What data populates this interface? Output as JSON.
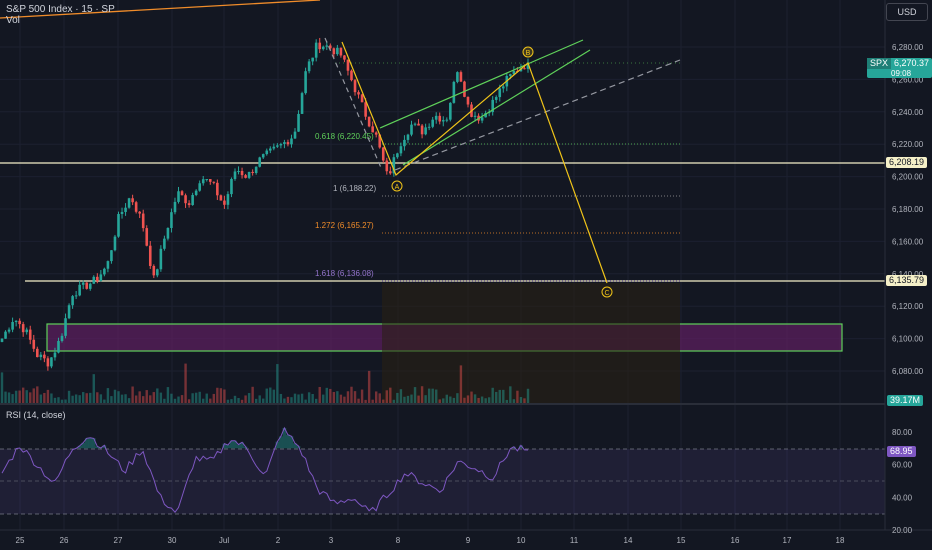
{
  "header": {
    "title": "S&P 500 Index · 15 · SP",
    "volume_label": "Vol",
    "currency_button": "USD",
    "rsi_label": "RSI (14, close)"
  },
  "price_axis": {
    "ticks": [
      "6,280.00",
      "6,260.00",
      "6,240.00",
      "6,220.00",
      "6,200.00",
      "6,180.00",
      "6,160.00",
      "6,140.00",
      "6,120.00",
      "6,100.00",
      "6,080.00"
    ],
    "last_symbol": "SPX",
    "last_price": "6,270.37",
    "last_countdown": "09:08",
    "level_high_label": "6,208.19",
    "level_low_label": "6,135.79",
    "volume_value": "39.17M"
  },
  "rsi_axis": {
    "ticks": [
      "80.00",
      "60.00",
      "40.00",
      "20.00"
    ],
    "value": "68.95"
  },
  "time_axis": {
    "ticks": [
      "25",
      "26",
      "27",
      "30",
      "Jul",
      "2",
      "3",
      "8",
      "9",
      "10",
      "11",
      "14",
      "15",
      "16",
      "17",
      "18"
    ]
  },
  "fib_labels": [
    "0.618 (6,220.45)",
    "1 (6,188.22)",
    "1.272 (6,165.27)",
    "1.618 (6,136.08)"
  ],
  "wave_labels": [
    "A",
    "B",
    "C"
  ],
  "colors": {
    "background": "#131722",
    "up": "#26a69a",
    "down": "#ef5350",
    "rsi_line": "#7e57c2",
    "wave_projection": "#f0c419",
    "channel": "#5fd15a",
    "demand_zone": "#5b1f5e",
    "level_line": "#f5f0c8",
    "fib_1": "#a0a0a0",
    "fib_1272": "#f08c2a",
    "fib_1618": "#7e57c2"
  },
  "chart_data": {
    "type": "candlestick",
    "symbol": "S&P 500 Index",
    "interval": "15",
    "y_range": [
      6070,
      6300
    ],
    "key_levels": [
      6208.19,
      6135.79
    ],
    "demand_zone": [
      6093,
      6108
    ],
    "fibonacci": [
      {
        "ratio": 0.618,
        "price": 6220.45
      },
      {
        "ratio": 1,
        "price": 6188.22
      },
      {
        "ratio": 1.272,
        "price": 6165.27
      },
      {
        "ratio": 1.618,
        "price": 6136.08
      }
    ],
    "waves": [
      {
        "label": "A",
        "price": 6199
      },
      {
        "label": "B",
        "price": 6271
      },
      {
        "label": "C",
        "price": 6136
      }
    ],
    "close_path": [
      [
        "25",
        6100
      ],
      [
        "25",
        6113
      ],
      [
        "25",
        6105
      ],
      [
        "25",
        6090
      ],
      [
        "26",
        6085
      ],
      [
        "26",
        6100
      ],
      [
        "26",
        6128
      ],
      [
        "26",
        6132
      ],
      [
        "26",
        6136
      ],
      [
        "27",
        6145
      ],
      [
        "27",
        6175
      ],
      [
        "27",
        6188
      ],
      [
        "27",
        6172
      ],
      [
        "30",
        6136
      ],
      [
        "30",
        6165
      ],
      [
        "30",
        6190
      ],
      [
        "30",
        6184
      ],
      [
        "Jul",
        6200
      ],
      [
        "Jul",
        6195
      ],
      [
        "Jul",
        6182
      ],
      [
        "Jul",
        6205
      ],
      [
        "2",
        6200
      ],
      [
        "2",
        6210
      ],
      [
        "2",
        6215
      ],
      [
        "2",
        6220
      ],
      [
        "3",
        6226
      ],
      [
        "3",
        6265
      ],
      [
        "3",
        6282
      ],
      [
        "3",
        6280
      ],
      [
        "3",
        6275
      ],
      [
        "3",
        6258
      ],
      [
        "3",
        6240
      ],
      [
        "8",
        6225
      ],
      [
        "8",
        6199
      ],
      [
        "8",
        6220
      ],
      [
        "8",
        6232
      ],
      [
        "9",
        6228
      ],
      [
        "9",
        6238
      ],
      [
        "9",
        6235
      ],
      [
        "9",
        6268
      ],
      [
        "9",
        6240
      ],
      [
        "9",
        6236
      ],
      [
        "10",
        6246
      ],
      [
        "10",
        6258
      ],
      [
        "10",
        6266
      ],
      [
        "10",
        6270.37
      ]
    ],
    "rsi": [
      55,
      72,
      60,
      48,
      70,
      78,
      68,
      56,
      70,
      40,
      30,
      64,
      62,
      76,
      70,
      52,
      82,
      70,
      45,
      36,
      40,
      30,
      42,
      55,
      49,
      44,
      62,
      58,
      52,
      70,
      68.95
    ],
    "rsi_range": [
      20,
      90
    ],
    "last_price": 6270.37,
    "last_rsi": 68.95
  }
}
